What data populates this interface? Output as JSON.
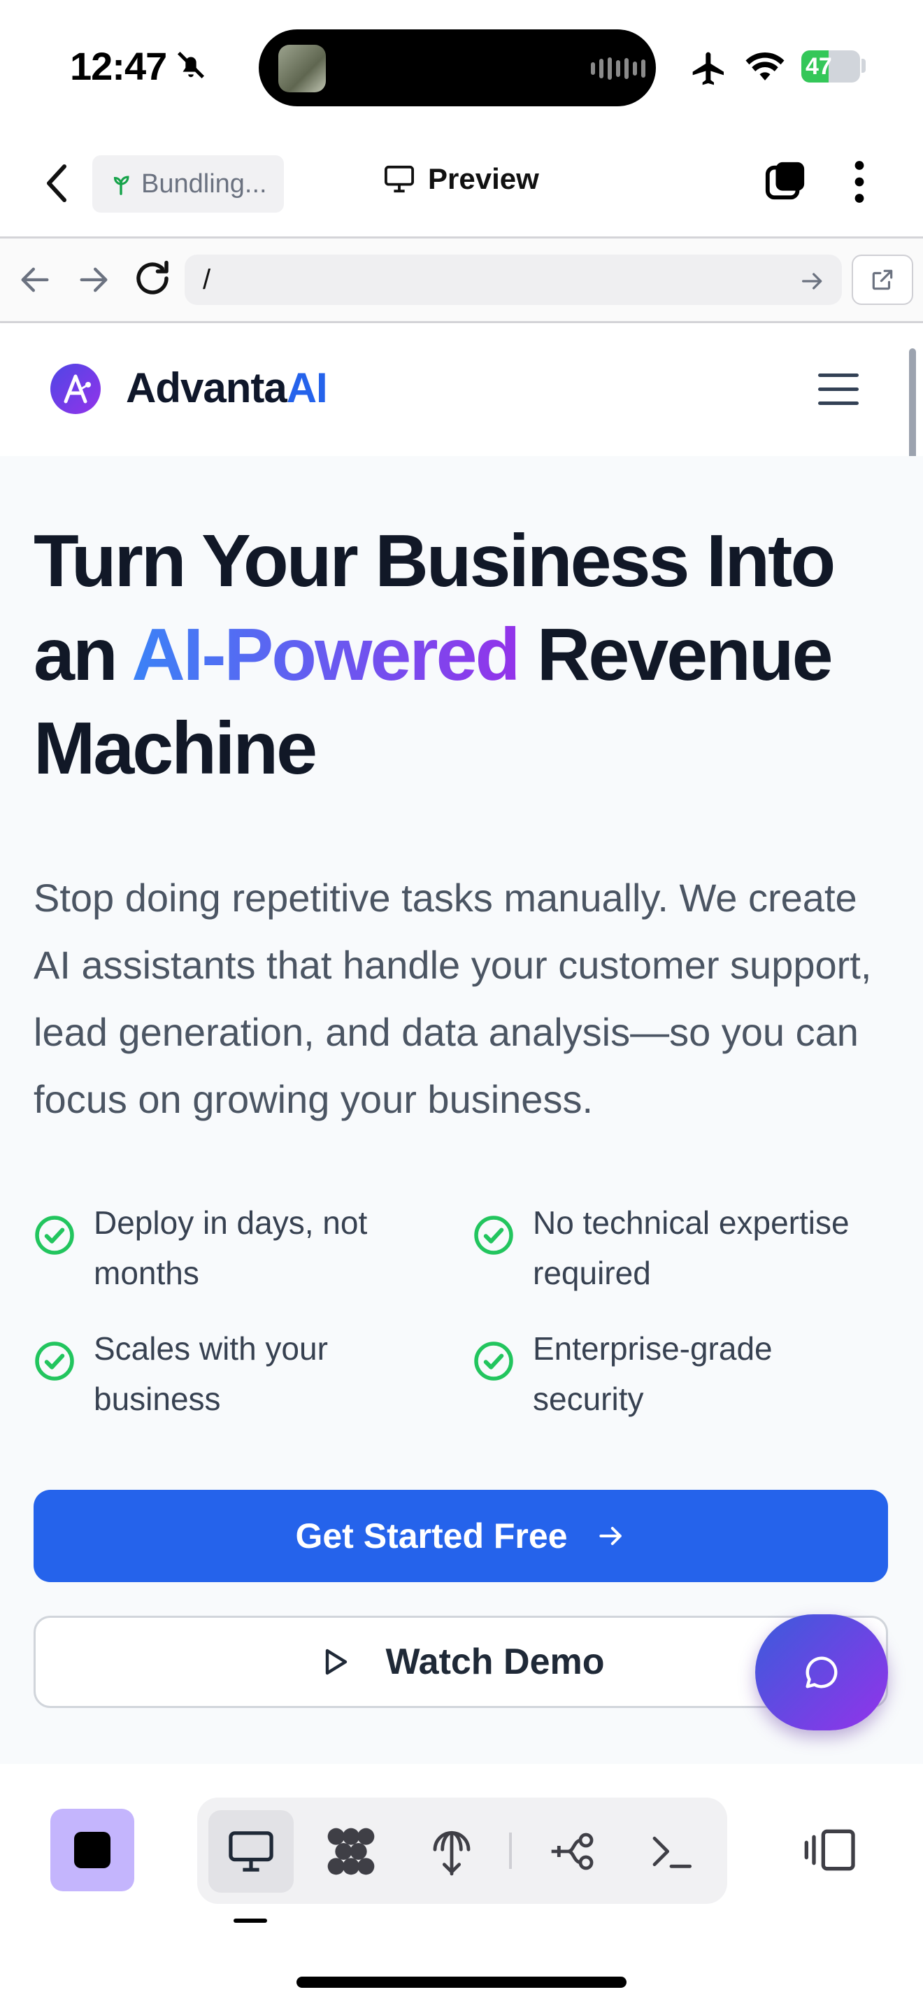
{
  "status_bar": {
    "time": "12:47",
    "battery": "47",
    "battery_level": 0.47
  },
  "app_header": {
    "bundling_label": "Bundling...",
    "preview_label": "Preview"
  },
  "url_bar": {
    "path": "/"
  },
  "site": {
    "brand_main": "Advanta",
    "brand_accent": "AI",
    "hero": {
      "title_part1": "Turn Your Business Into an ",
      "title_highlight": "AI-Powered",
      "title_part2": " Revenue Machine",
      "subtitle": "Stop doing repetitive tasks manually. We create AI assistants that handle your customer support, lead generation, and data analysis—so you can focus on growing your business.",
      "features": [
        "Deploy in days, not months",
        "No technical expertise required",
        "Scales with your business",
        "Enterprise-grade security"
      ],
      "cta_primary": "Get Started Free",
      "cta_secondary": "Watch Demo"
    }
  },
  "colors": {
    "primary": "#2563eb",
    "check": "#22c55e",
    "accent_gradient_start": "#3b82f6",
    "accent_gradient_end": "#9333ea",
    "stop_button": "#c4b5fd"
  },
  "bottom_toolbar": {
    "items": [
      "monitor-icon",
      "apps-grid-icon",
      "deploy-icon",
      "workflow-icon",
      "terminal-icon"
    ],
    "active_item": "monitor-icon"
  }
}
